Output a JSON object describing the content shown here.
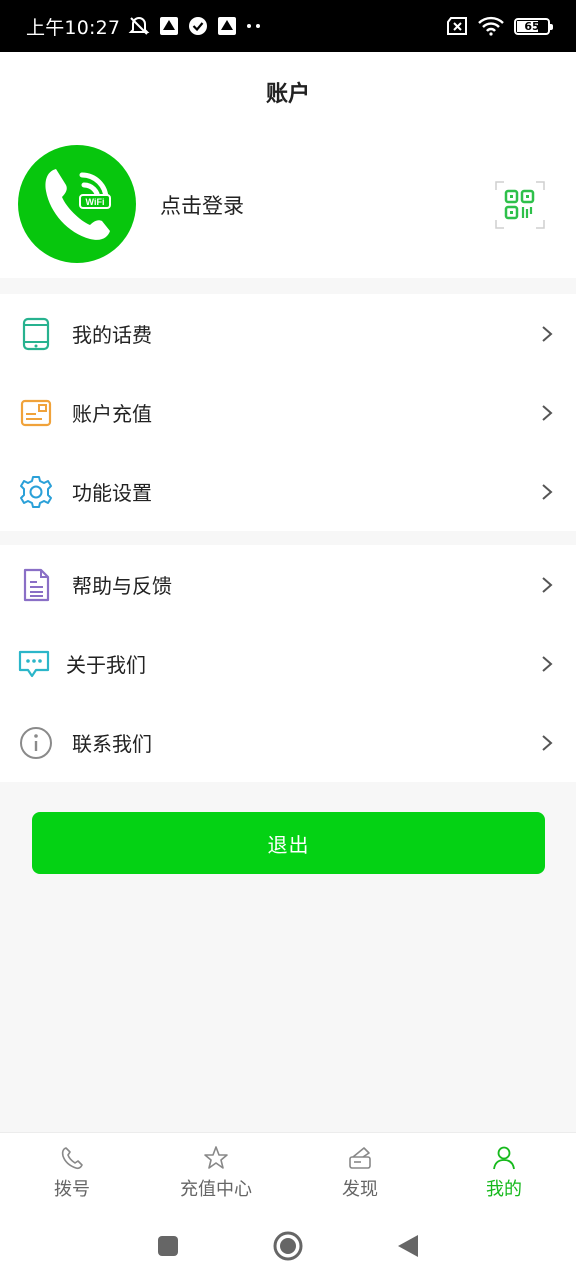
{
  "status_bar": {
    "time": "上午10:27",
    "battery_level": "65",
    "battery_fraction": 0.65
  },
  "header": {
    "title": "账户"
  },
  "profile": {
    "login_text": "点击登录",
    "avatar_badge": "WiFi"
  },
  "menu_group_1": [
    {
      "label": "我的话费",
      "icon": "phone-device-icon",
      "color": "#27b28f"
    },
    {
      "label": "账户充值",
      "icon": "card-icon",
      "color": "#f0a23a"
    },
    {
      "label": "功能设置",
      "icon": "gear-icon",
      "color": "#2aa0d8"
    }
  ],
  "menu_group_2": [
    {
      "label": "帮助与反馈",
      "icon": "document-icon",
      "color": "#8a6fc6"
    },
    {
      "label": "关于我们",
      "icon": "chat-bubble-icon",
      "color": "#2bb6c9"
    },
    {
      "label": "联系我们",
      "icon": "info-icon",
      "color": "#8a8a8a"
    }
  ],
  "logout_label": "退出",
  "tabs": [
    {
      "label": "拨号",
      "icon": "phone-icon",
      "active": false
    },
    {
      "label": "充值中心",
      "icon": "star-icon",
      "active": false
    },
    {
      "label": "发现",
      "icon": "discover-icon",
      "active": false
    },
    {
      "label": "我的",
      "icon": "person-icon",
      "active": true
    }
  ],
  "colors": {
    "brand_green": "#07c60d",
    "button_green": "#04d214",
    "active_tab": "#16b91c"
  }
}
